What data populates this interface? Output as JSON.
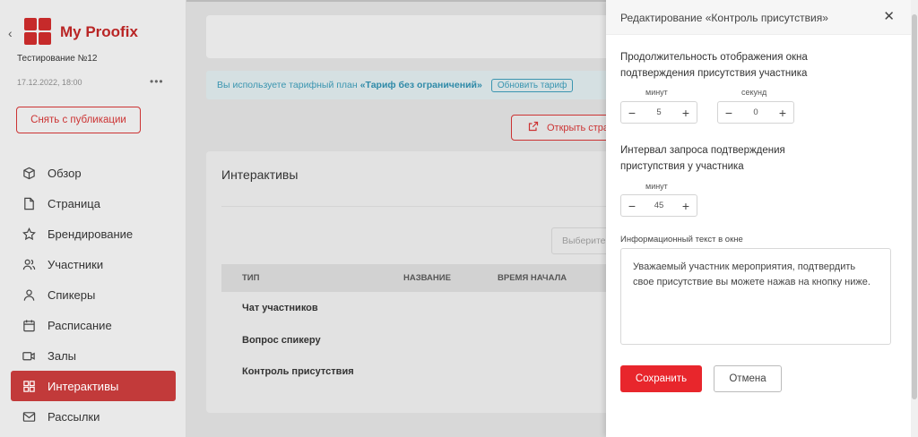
{
  "sidebar": {
    "back_glyph": "‹",
    "app_title": "My Proofix",
    "project_name": "Тестирование №12",
    "datetime": "17.12.2022, 18:00",
    "more_glyph": "•••",
    "unpublish_label": "Снять с публикации",
    "items": [
      {
        "label": "Обзор",
        "icon": "cube-icon"
      },
      {
        "label": "Страница",
        "icon": "page-icon"
      },
      {
        "label": "Брендирование",
        "icon": "star-icon"
      },
      {
        "label": "Участники",
        "icon": "users-icon"
      },
      {
        "label": "Спикеры",
        "icon": "user-icon"
      },
      {
        "label": "Расписание",
        "icon": "calendar-icon"
      },
      {
        "label": "Залы",
        "icon": "video-icon"
      },
      {
        "label": "Интерактивы",
        "icon": "grid-icon",
        "active": true
      },
      {
        "label": "Рассылки",
        "icon": "mail-icon"
      }
    ]
  },
  "main": {
    "plan_text": "Вы используете тарифный план",
    "plan_name": "«Тариф без ограничений»",
    "plan_button": "Обновить тариф",
    "open_page_label": "Открыть страницу",
    "card_title": "Интерактивы",
    "select_placeholder": "Выберите",
    "columns": [
      "ТИП",
      "НАЗВАНИЕ",
      "ВРЕМЯ НАЧАЛА"
    ],
    "rows": [
      "Чат участников",
      "Вопрос спикеру",
      "Контроль присутствия"
    ]
  },
  "drawer": {
    "title": "Редактирование «Контроль присутствия»",
    "close_glyph": "✕",
    "duration_label": "Продолжительность отображения окна подтверждения присутствия участника",
    "minutes_label": "минут",
    "seconds_label": "секунд",
    "duration_minutes": "5",
    "duration_seconds": "0",
    "interval_label": "Интервал запроса подтверждения приступствия у участника",
    "interval_minutes_label": "минут",
    "interval_minutes": "45",
    "minus_glyph": "−",
    "plus_glyph": "+",
    "info_label": "Информационный текст в окне",
    "info_text": "Уважаемый участник мероприятия, подтвердить свое присутствие вы можете нажав на кнопку ниже.",
    "save_label": "Сохранить",
    "cancel_label": "Отмена"
  },
  "colors": {
    "brand": "#c62a2a",
    "save": "#e8262c",
    "plan": "#3a95b0"
  }
}
